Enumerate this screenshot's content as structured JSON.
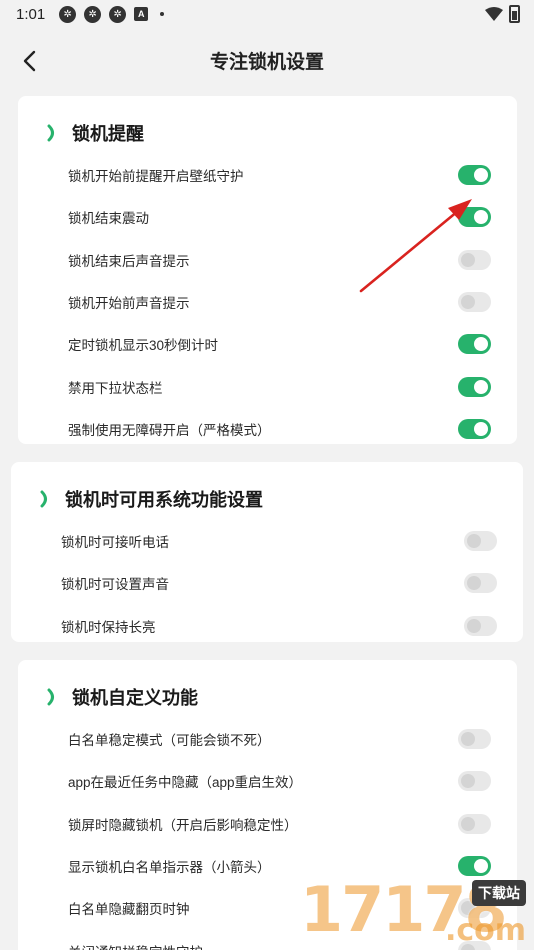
{
  "status_bar": {
    "time": "1:01",
    "notification_icons": [
      "settings-icon",
      "settings-icon",
      "settings-icon",
      "a-icon"
    ]
  },
  "header": {
    "title": "专注锁机设置"
  },
  "colors": {
    "accent": "#27b26c",
    "toggle_off": "#e8e8e8",
    "arrow": "#d9231f"
  },
  "sections": [
    {
      "title": "锁机提醒",
      "rows": [
        {
          "label": "锁机开始前提醒开启壁纸守护",
          "on": true
        },
        {
          "label": "锁机结束震动",
          "on": true
        },
        {
          "label": "锁机结束后声音提示",
          "on": false
        },
        {
          "label": "锁机开始前声音提示",
          "on": false
        },
        {
          "label": "定时锁机显示30秒倒计时",
          "on": true
        },
        {
          "label": "禁用下拉状态栏",
          "on": true
        },
        {
          "label": "强制使用无障碍开启（严格模式）",
          "on": true
        }
      ]
    },
    {
      "title": "锁机时可用系统功能设置",
      "rows": [
        {
          "label": "锁机时可接听电话",
          "on": false
        },
        {
          "label": "锁机时可设置声音",
          "on": false
        },
        {
          "label": "锁机时保持长亮",
          "on": false
        }
      ]
    },
    {
      "title": "锁机自定义功能",
      "rows": [
        {
          "label": "白名单稳定模式（可能会锁不死）",
          "on": false
        },
        {
          "label": "app在最近任务中隐藏（app重启生效）",
          "on": false
        },
        {
          "label": "锁屏时隐藏锁机（开启后影响稳定性）",
          "on": false
        },
        {
          "label": "显示锁机白名单指示器（小箭头）",
          "on": true
        },
        {
          "label": "白名单隐藏翻页时钟",
          "on": false
        },
        {
          "label": "关闭通知栏稳定性守护",
          "on": false
        }
      ]
    }
  ],
  "watermark": {
    "digits": "17178",
    "badge": "下载站",
    "suffix": ".com"
  }
}
